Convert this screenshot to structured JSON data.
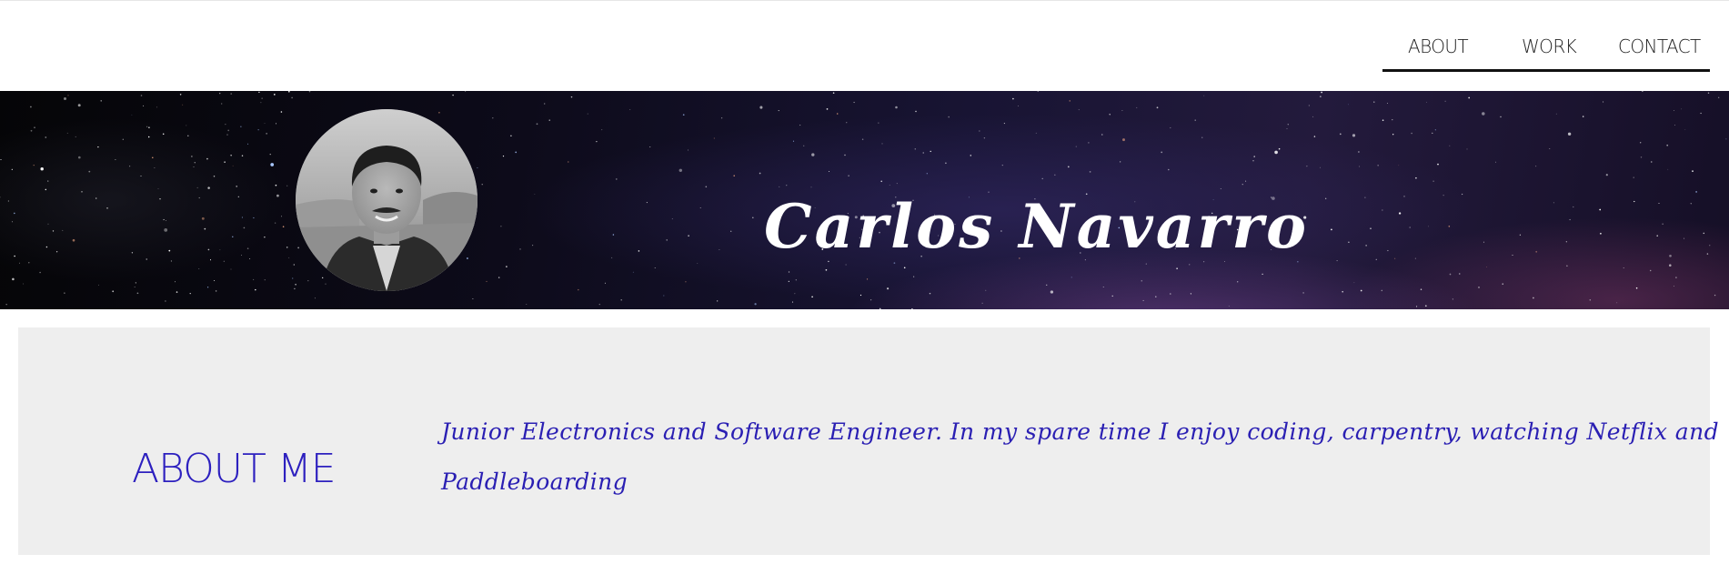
{
  "nav": {
    "items": [
      {
        "label": "ABOUT"
      },
      {
        "label": "WORK"
      },
      {
        "label": "CONTACT"
      }
    ]
  },
  "header": {
    "name": "Carlos Navarro",
    "avatar_icon": "profile-photo"
  },
  "about": {
    "heading": "ABOUT ME",
    "text": "Junior Electronics and Software Engineer. In my spare time I enjoy coding, carpentry, watching Netflix and Paddleboarding"
  },
  "colors": {
    "accent": "#2d20bf",
    "nav_text": "#222222",
    "section_bg": "#eeeeee",
    "banner_text": "#ffffff"
  }
}
